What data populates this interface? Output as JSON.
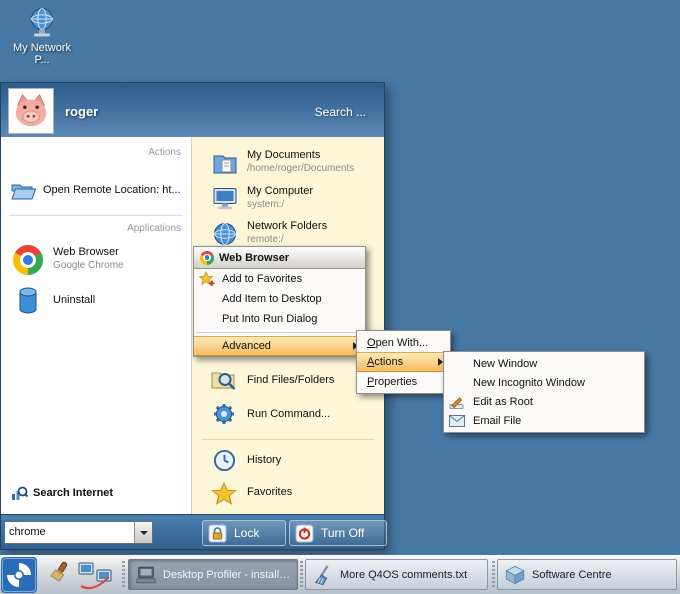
{
  "colors": {
    "desktop_bg": "#4779a5",
    "menu_header_blue": "#3f6f9e",
    "right_panel_cream": "#fdf6d9",
    "menu_highlight_orange": "#f5bc60",
    "taskbar_gray": "#c6ced7"
  },
  "desktop_icon": {
    "label": "My Network P..."
  },
  "kmenu": {
    "header": {
      "username": "roger",
      "search": "Search ..."
    },
    "left": {
      "section_actions": "Actions",
      "open_remote": "Open Remote Location: ht...",
      "section_applications": "Applications",
      "web_browser_title": "Web Browser",
      "web_browser_subtitle": "Google Chrome",
      "uninstall": "Uninstall",
      "search_internet": "Search Internet"
    },
    "right": {
      "items": [
        {
          "title": "My Documents",
          "subtitle": "/home/roger/Documents"
        },
        {
          "title": "My Computer",
          "subtitle": "system:/"
        },
        {
          "title": "Network Folders",
          "subtitle": "remote:/"
        }
      ],
      "find_files": "Find Files/Folders",
      "run_command": "Run Command...",
      "history": "History",
      "favorites": "Favorites"
    },
    "footer": {
      "search_value": "chrome",
      "lock": "Lock",
      "turn_off": "Turn Off"
    }
  },
  "context_menu": {
    "title": "Web Browser",
    "add_to_favorites": "Add to Favorites",
    "add_item_to_desktop": "Add Item to Desktop",
    "put_into_run_dialog": "Put Into Run Dialog",
    "advanced": "Advanced"
  },
  "submenu": {
    "open_with": "Open With...",
    "actions": "Actions",
    "properties": "Properties"
  },
  "actions_submenu": {
    "new_window": "New Window",
    "new_incognito": "New Incognito Window",
    "edit_as_root": "Edit as Root",
    "email_file": "Email File"
  },
  "taskbar": {
    "tasks": [
      {
        "label": "Desktop Profiler - install pro"
      },
      {
        "label": "More Q4OS comments.txt"
      },
      {
        "label": "Software Centre"
      }
    ]
  },
  "icon_names": [
    "network-globe-icon",
    "pig-avatar",
    "open-folder-icon",
    "chrome-icon",
    "uninstall-drive-icon",
    "search-internet-icon",
    "documents-folder-icon",
    "my-computer-icon",
    "network-folders-icon",
    "find-files-icon",
    "run-gear-icon",
    "history-clock-icon",
    "favorites-star-icon",
    "star-plus-icon",
    "edit-as-root-icon",
    "email-file-icon",
    "lock-icon",
    "power-icon",
    "dropdown-arrow-icon",
    "q4os-start-icon",
    "paintbrush-icon",
    "network-places-icon",
    "profiler-task-icon",
    "broom-task-icon",
    "software-centre-icon"
  ]
}
